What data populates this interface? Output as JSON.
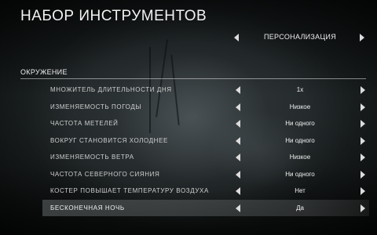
{
  "screen": {
    "title": "Набор инструментов"
  },
  "preset": {
    "value": "ПЕРСОНАЛИЗАЦИЯ"
  },
  "section": {
    "title": "ОКРУЖЕНИЕ"
  },
  "settings": [
    {
      "label": "Множитель длительности дня",
      "value": "1x"
    },
    {
      "label": "Изменяемость погоды",
      "value": "Низкое"
    },
    {
      "label": "Частота метелей",
      "value": "Ни одного"
    },
    {
      "label": "Вокруг становится холоднее",
      "value": "Ни одного"
    },
    {
      "label": "Изменяемость ветра",
      "value": "Низкое"
    },
    {
      "label": "Частота северного сияния",
      "value": "Ни одного"
    },
    {
      "label": "Костер повышает температуру воздуха",
      "value": "Нет"
    },
    {
      "label": "Бесконечная ночь",
      "value": "Да"
    }
  ],
  "icons": {
    "left": "arrow-left-icon",
    "right": "arrow-right-icon"
  }
}
